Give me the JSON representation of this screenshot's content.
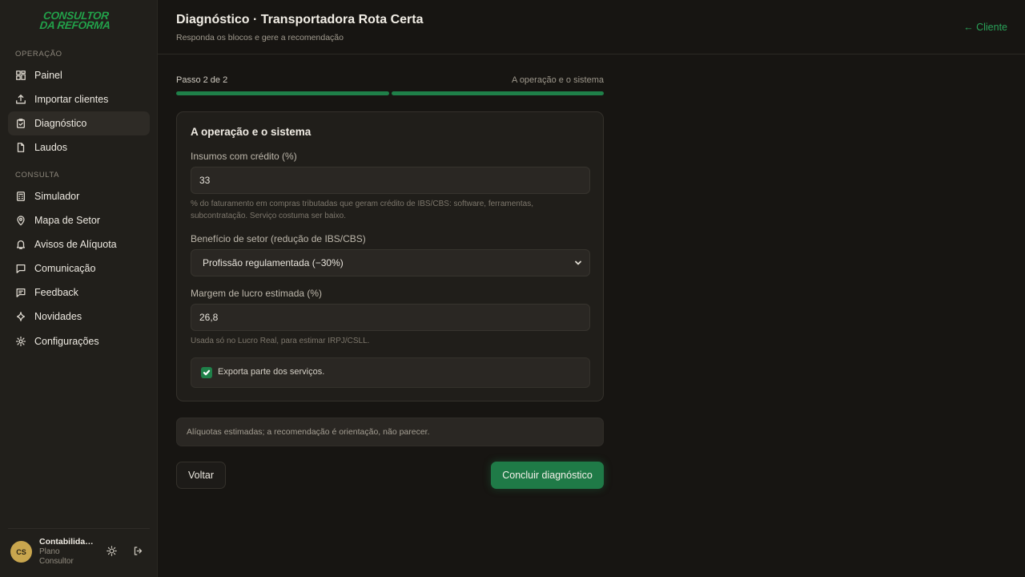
{
  "brand": {
    "line1": "CONSULTOR",
    "line2": "DA REFORMA",
    "color": "#22a14a"
  },
  "sidebar": {
    "section_operacao": "OPERAÇÃO",
    "section_consulta": "CONSULTA",
    "items": [
      {
        "label": "Painel",
        "icon": "grid-icon"
      },
      {
        "label": "Importar clientes",
        "icon": "upload-icon"
      },
      {
        "label": "Diagnóstico",
        "icon": "clipboard-check-icon",
        "active": true
      },
      {
        "label": "Laudos",
        "icon": "file-icon"
      },
      {
        "label": "Simulador",
        "icon": "calculator-icon"
      },
      {
        "label": "Mapa de Setor",
        "icon": "map-pin-icon"
      },
      {
        "label": "Avisos de Alíquota",
        "icon": "bell-icon"
      },
      {
        "label": "Comunicação",
        "icon": "chat-icon"
      },
      {
        "label": "Feedback",
        "icon": "message-square-icon"
      },
      {
        "label": "Novidades",
        "icon": "sparkle-icon"
      },
      {
        "label": "Configurações",
        "icon": "gear-icon"
      }
    ],
    "user": {
      "initials": "CS",
      "name": "Contabilidad...",
      "plan": "Plano Consultor"
    }
  },
  "header": {
    "title": "Diagnóstico · Transportadora Rota Certa",
    "subtitle": "Responda os blocos e gere a recomendação",
    "back_link": "← Cliente"
  },
  "progress": {
    "step_text": "Passo 2 de 2",
    "step_name": "A operação e o sistema",
    "current": 2,
    "total": 2
  },
  "form": {
    "title": "A operação e o sistema",
    "insumos": {
      "label": "Insumos com crédito (%)",
      "value": "33",
      "hint": "% do faturamento em compras tributadas que geram crédito de IBS/CBS: software, ferramentas, subcontratação. Serviço costuma ser baixo."
    },
    "beneficio": {
      "label": "Benefício de setor (redução de IBS/CBS)",
      "selected": "Profissão regulamentada (−30%)"
    },
    "margem": {
      "label": "Margem de lucro estimada (%)",
      "value": "26,8",
      "hint": "Usada só no Lucro Real, para estimar IRPJ/CSLL."
    },
    "exporta": {
      "label": "Exporta parte dos serviços.",
      "checked": true
    }
  },
  "disclaimer": "Alíquotas estimadas; a recomendação é orientação, não parecer.",
  "actions": {
    "back": "Voltar",
    "submit": "Concluir diagnóstico"
  },
  "colors": {
    "accent": "#1f7a47",
    "background": "#171512",
    "sidebar": "#211f1b"
  }
}
